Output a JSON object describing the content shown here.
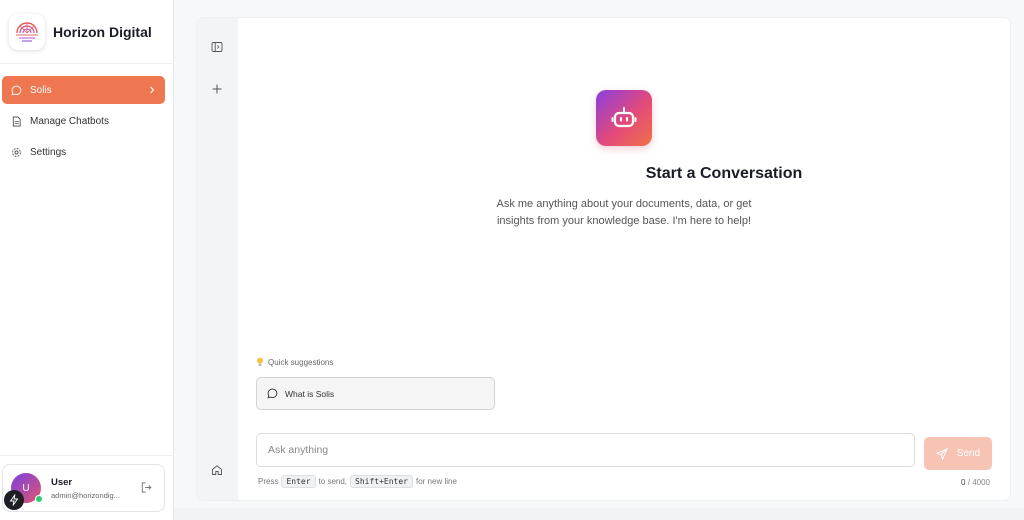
{
  "brand": {
    "name": "Horizon Digital"
  },
  "nav": {
    "items": [
      {
        "label": "Solis",
        "icon": "chat-bubble-icon",
        "active": true
      },
      {
        "label": "Manage Chatbots",
        "icon": "document-icon",
        "active": false
      },
      {
        "label": "Settings",
        "icon": "gear-icon",
        "active": false
      }
    ]
  },
  "user": {
    "initial": "U",
    "name": "User",
    "email": "admin@horizondig..."
  },
  "hero": {
    "title": "Start a Conversation",
    "subtitle": "Ask me anything about your documents, data, or get insights from your knowledge base. I'm here to help!"
  },
  "suggestions": {
    "label": "Quick suggestions",
    "items": [
      "What is Solis"
    ]
  },
  "composer": {
    "placeholder": "Ask anything",
    "send_label": "Send",
    "hint_press": "Press",
    "hint_enter": "Enter",
    "hint_to_send": "to send,",
    "hint_shift_enter": "Shift+Enter",
    "hint_new_line": "for new line",
    "count": "0",
    "count_sep": "/",
    "max": "4000"
  },
  "colors": {
    "accent": "#ee7650",
    "send_disabled": "#f6c3b4"
  }
}
